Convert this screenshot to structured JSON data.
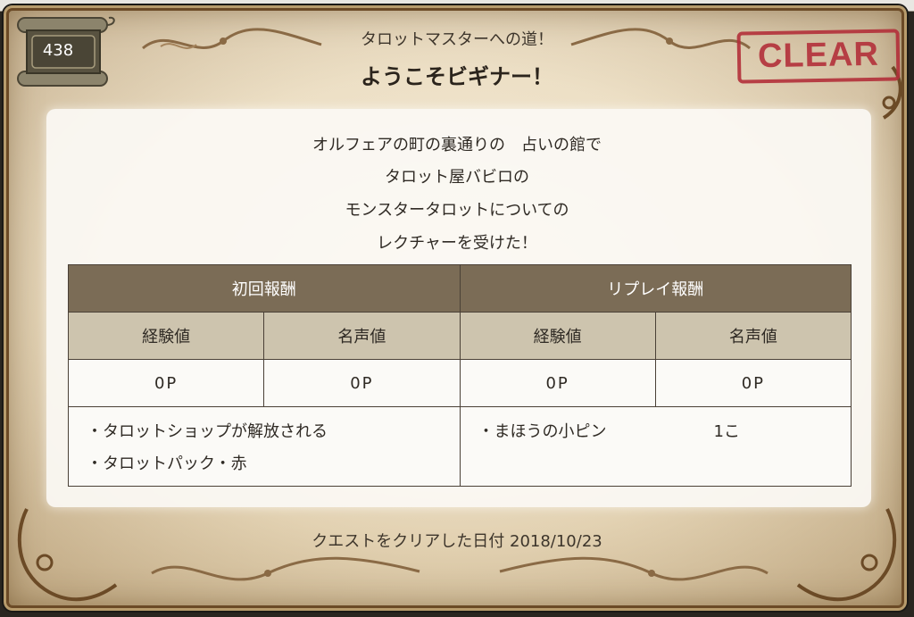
{
  "quest_number": "438",
  "subtitle": "タロットマスターへの道！",
  "title": "ようこそビギナー！",
  "clear_stamp": "CLEAR",
  "description": [
    "オルフェアの町の裏通りの　占いの館で",
    "タロット屋バビロの",
    "モンスタータロットについての",
    "レクチャーを受けた！"
  ],
  "rewards": {
    "first": {
      "header": "初回報酬",
      "exp_label": "経験値",
      "fame_label": "名声値",
      "exp_value": "0P",
      "fame_value": "0P",
      "items": [
        "・タロットショップが解放される",
        "・タロットパック・赤"
      ]
    },
    "replay": {
      "header": "リプレイ報酬",
      "exp_label": "経験値",
      "fame_label": "名声値",
      "exp_value": "0P",
      "fame_value": "0P",
      "items": [
        {
          "name": "・まほうの小ピン",
          "qty": "1こ"
        }
      ]
    }
  },
  "footer": "クエストをクリアした日付 2018/10/23",
  "colors": {
    "header_bg": "#7b6c56",
    "subheader_bg": "#cdc4ae",
    "stamp": "#b3303a",
    "parchment": "#e6d6b7"
  }
}
